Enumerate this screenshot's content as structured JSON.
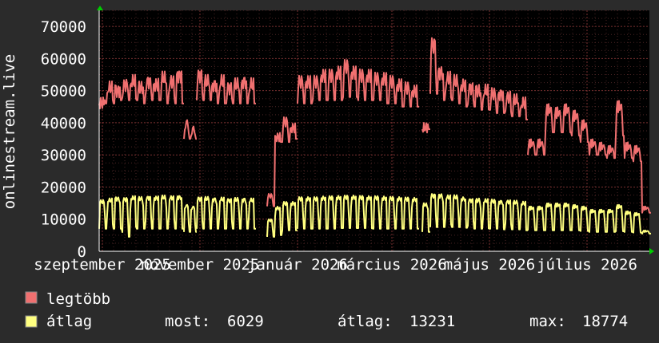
{
  "chart_data": {
    "type": "line",
    "ylabel": "onlinestream.live",
    "ylim": [
      0,
      75000
    ],
    "y_ticks": [
      "0",
      "10000",
      "20000",
      "30000",
      "40000",
      "50000",
      "60000",
      "70000"
    ],
    "y_tick_values": [
      0,
      10000,
      20000,
      30000,
      40000,
      50000,
      60000,
      70000
    ],
    "x_ticks": [
      "szeptember 2025",
      "november 2025",
      "január 2026",
      "március 2026",
      "május 2026",
      "július 2026"
    ],
    "x_tick_days": [
      0,
      61,
      122,
      181,
      242,
      303
    ],
    "xlim_days": [
      -2,
      342
    ],
    "grid": true,
    "series": [
      {
        "name": "legtöbb",
        "color": "#f07070",
        "segments": [
          {
            "start_day": -2,
            "end_day": 51,
            "weekday": [
              48000,
              53000,
              52000,
              54000,
              55000,
              53000,
              55000,
              54000,
              56000,
              55000,
              57000
            ],
            "weekend": [
              46000,
              46000,
              47000,
              47000,
              47000,
              46000,
              47000,
              47000,
              46000,
              46000,
              46000
            ]
          },
          {
            "start_day": 51,
            "end_day": 59,
            "weekday": [
              41000,
              39000
            ],
            "weekend": [
              35000,
              35000
            ]
          },
          {
            "start_day": 59,
            "end_day": 96,
            "weekday": [
              57000,
              55000,
              54000,
              55000,
              53000,
              54000,
              55000,
              54000
            ],
            "weekend": [
              47000,
              47000,
              46000,
              46000,
              46000,
              46000,
              46000,
              46000
            ]
          },
          {
            "start_day": 103,
            "end_day": 122,
            "weekday": [
              18000,
              37000,
              42000,
              40000
            ],
            "weekend": [
              14000,
              34000,
              34000,
              35000
            ]
          },
          {
            "start_day": 122,
            "end_day": 198,
            "weekday": [
              55000,
              55000,
              55000,
              57000,
              57000,
              58000,
              60000,
              58000,
              57000,
              57000,
              56000,
              56000,
              55000,
              54000,
              53000,
              52000
            ],
            "weekend": [
              46000,
              46000,
              47000,
              47000,
              47000,
              47000,
              48000,
              48000,
              47000,
              47000,
              47000,
              46000,
              46000,
              45000,
              45000,
              45000
            ]
          },
          {
            "start_day": 200,
            "end_day": 205,
            "weekday": [
              40000
            ],
            "weekend": [
              38000
            ]
          },
          {
            "start_day": 205,
            "end_day": 266,
            "weekday": [
              67000,
              58000,
              56000,
              55000,
              54000,
              53000,
              52000,
              52000,
              51000,
              51000,
              50000,
              49000,
              48000
            ],
            "weekend": [
              49000,
              47000,
              47000,
              46000,
              45000,
              45000,
              44000,
              44000,
              43000,
              43000,
              42000,
              42000,
              41000
            ]
          },
          {
            "start_day": 266,
            "end_day": 343,
            "weekday": [
              35000,
              35000,
              46000,
              45000,
              46000,
              44000,
              41000,
              35000,
              34000,
              33000,
              47000,
              34000,
              33000,
              14000
            ],
            "weekend": [
              30000,
              30000,
              37000,
              37000,
              37000,
              36000,
              34000,
              30000,
              30000,
              29000,
              36000,
              29000,
              28000,
              12000
            ]
          }
        ]
      },
      {
        "name": "átlag",
        "color": "#ffff80",
        "segments": [
          {
            "start_day": -2,
            "end_day": 51,
            "weekday": [
              16000,
              16500,
              17000,
              16800,
              17200,
              17000,
              17300,
              17200,
              17400,
              17300,
              17500
            ],
            "weekend": [
              7000,
              7000,
              7000,
              4500,
              7000,
              7000,
              7000,
              7000,
              7000,
              7000,
              7000
            ]
          },
          {
            "start_day": 51,
            "end_day": 59,
            "weekday": [
              14500,
              14000
            ],
            "weekend": [
              6000,
              6000
            ]
          },
          {
            "start_day": 59,
            "end_day": 96,
            "weekday": [
              17000,
              17000,
              16800,
              16800,
              16500,
              16700,
              16700,
              16500
            ],
            "weekend": [
              7000,
              7000,
              7000,
              7000,
              7000,
              7000,
              7000,
              7000
            ]
          },
          {
            "start_day": 103,
            "end_day": 122,
            "weekday": [
              10000,
              14000,
              15500,
              15500
            ],
            "weekend": [
              4500,
              5000,
              6500,
              6500
            ]
          },
          {
            "start_day": 122,
            "end_day": 198,
            "weekday": [
              17000,
              17000,
              17000,
              17200,
              17300,
              17400,
              17500,
              17500,
              17400,
              17300,
              17300,
              17200,
              17100,
              17000,
              16900,
              16800
            ],
            "weekend": [
              7000,
              7000,
              7000,
              7000,
              7000,
              7200,
              7200,
              7200,
              7200,
              7100,
              7000,
              7000,
              7000,
              7000,
              7000,
              7000
            ]
          },
          {
            "start_day": 200,
            "end_day": 205,
            "weekday": [
              15000
            ],
            "weekend": [
              6000
            ]
          },
          {
            "start_day": 205,
            "end_day": 266,
            "weekday": [
              18000,
              18000,
              17500,
              17500,
              17000,
              16500,
              16500,
              16300,
              16200,
              16000,
              16000,
              15800,
              15500
            ],
            "weekend": [
              7500,
              7500,
              7500,
              7500,
              7300,
              7000,
              7000,
              7000,
              7000,
              6800,
              6800,
              6800,
              6500
            ]
          },
          {
            "start_day": 266,
            "end_day": 343,
            "weekday": [
              14000,
              14000,
              15000,
              15000,
              15000,
              14500,
              14000,
              13000,
              13000,
              13000,
              14500,
              12500,
              12000,
              6500
            ],
            "weekend": [
              6500,
              6500,
              6500,
              6500,
              6500,
              6500,
              6300,
              6000,
              6000,
              6000,
              6200,
              6000,
              5800,
              5500
            ]
          }
        ]
      }
    ]
  },
  "legend": {
    "items": [
      {
        "label": "legtöbb",
        "color": "#f07070"
      },
      {
        "label": "átlag",
        "color": "#ffff80"
      }
    ],
    "stats": {
      "now_label": "most:",
      "now_value": "6029",
      "avg_label": "átlag:",
      "avg_value": "13231",
      "max_label": "max:",
      "max_value": "18774"
    }
  },
  "colors": {
    "background": "#2b2b2b",
    "plot_background": "#000000",
    "grid": "#5a2a2a",
    "axis": "#ffffff",
    "arrow": "#00cc00"
  }
}
